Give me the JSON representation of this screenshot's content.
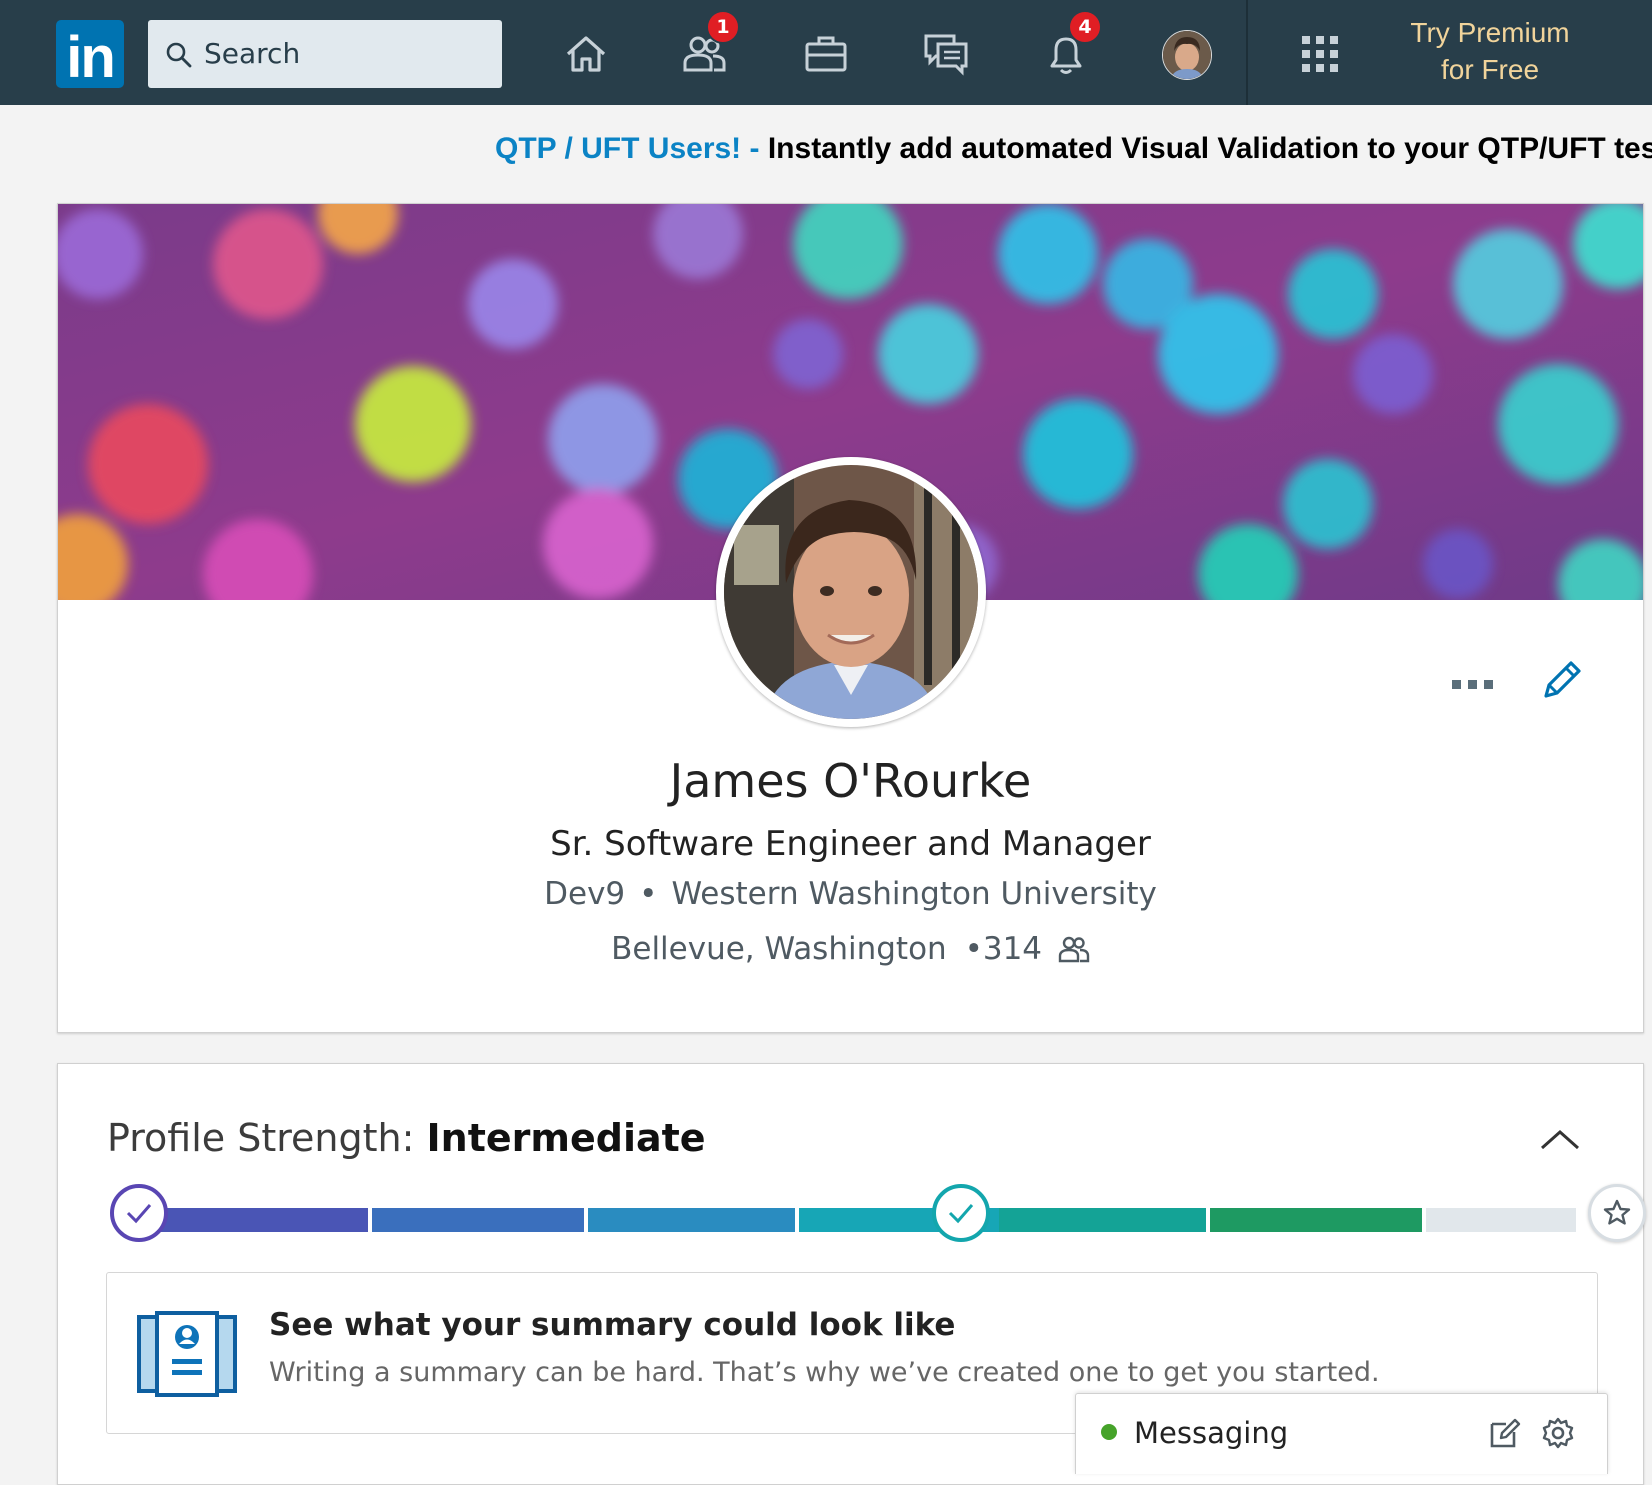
{
  "nav": {
    "logo": "in",
    "search_placeholder": "Search",
    "icons": [
      "home-icon",
      "my-network-icon",
      "jobs-icon",
      "messaging-icon",
      "notifications-icon",
      "me-avatar",
      "work-grid-icon"
    ],
    "network_badge": "1",
    "notifications_badge": "4",
    "premium_line1": "Try Premium",
    "premium_line2": "for Free"
  },
  "ad": {
    "link_text": "QTP / UFT Users! -",
    "text": "Instantly add automated Visual Validation to your QTP/UFT tes"
  },
  "profile": {
    "name": "James O'Rourke",
    "headline": "Sr. Software Engineer and Manager",
    "company": "Dev9",
    "school": "Western Washington University",
    "location": "Bellevue, Washington",
    "connections": "314",
    "separator": "•"
  },
  "strength": {
    "label": "Profile Strength: ",
    "level": "Intermediate",
    "completed_fraction": 0.86
  },
  "summary": {
    "title": "See what your summary could look like",
    "text": "Writing a summary can be hard. That’s why we’ve created one to get you started."
  },
  "messaging": {
    "label": "Messaging",
    "status_color": "#46a32a"
  },
  "colors": {
    "nav_bg": "#283e4a",
    "brand_blue": "#0073b1",
    "premium_gold": "#f1d49b",
    "ad_link": "#0b83c5",
    "badge_red": "#e01e24"
  }
}
